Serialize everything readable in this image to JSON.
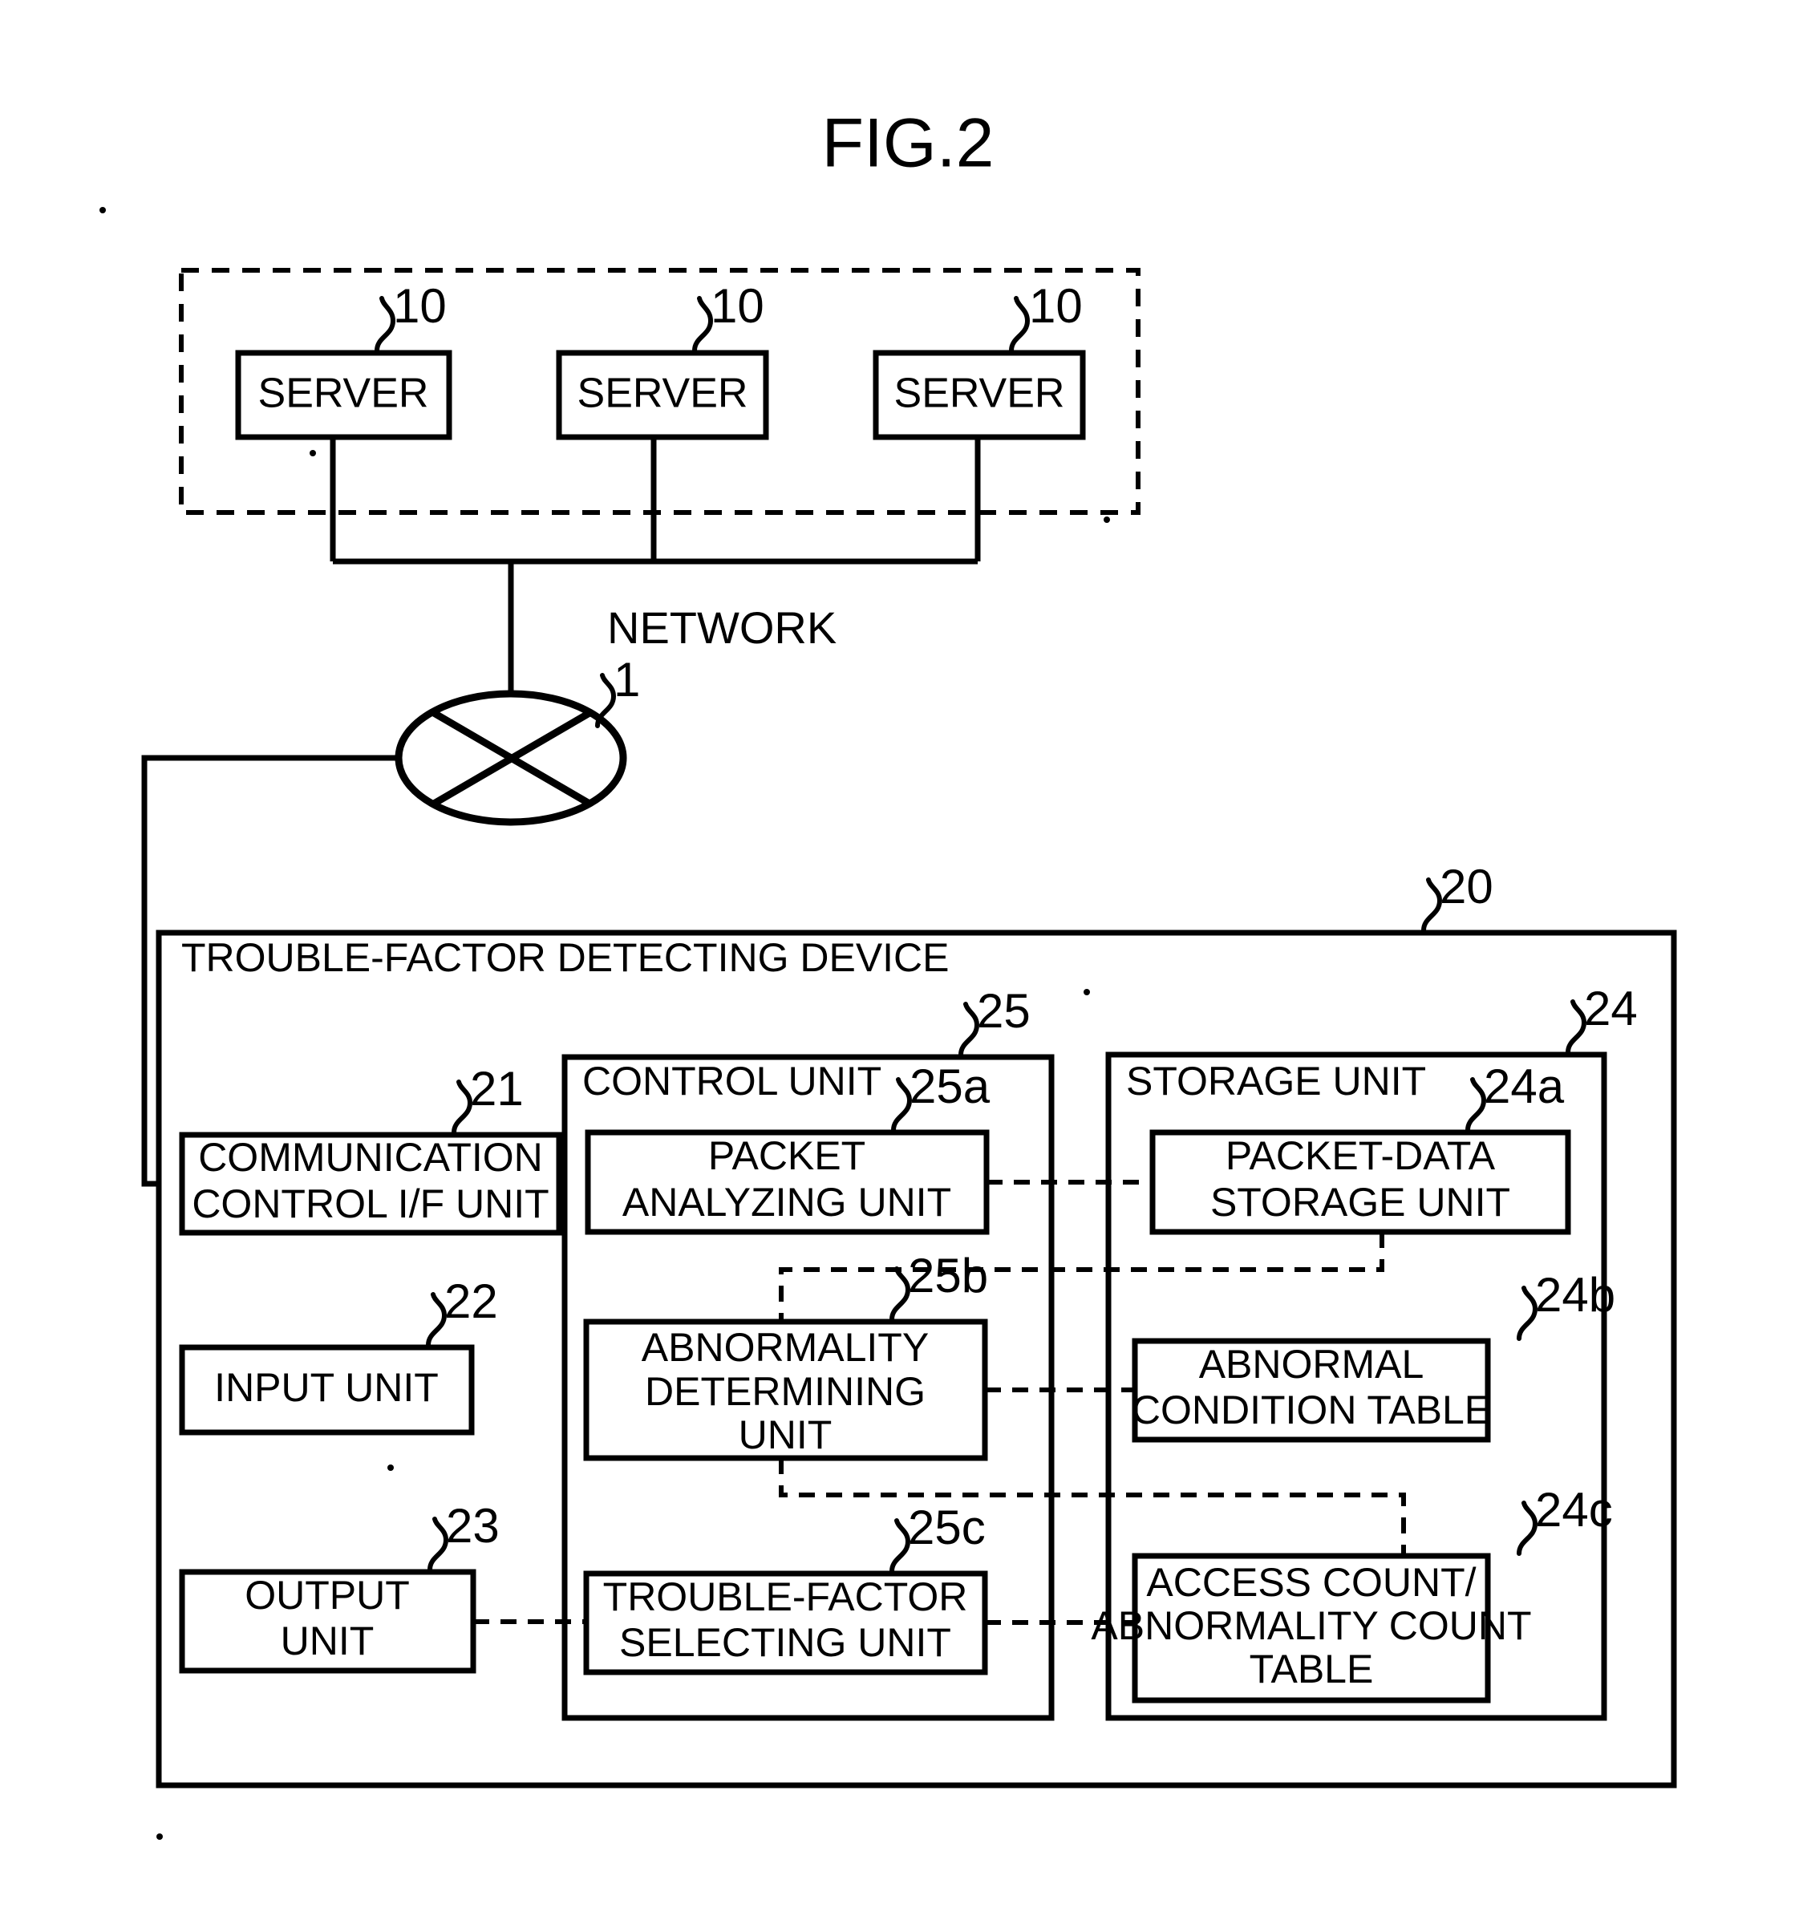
{
  "figure": {
    "title": "FIG.2",
    "caption_network": "NETWORK",
    "device_title": "TROUBLE-FACTOR DETECTING DEVICE"
  },
  "servers": {
    "label": "SERVER",
    "ref": "10",
    "items": [
      {
        "label": "SERVER",
        "ref": "10"
      },
      {
        "label": "SERVER",
        "ref": "10"
      },
      {
        "label": "SERVER",
        "ref": "10"
      }
    ]
  },
  "network": {
    "label": "NETWORK",
    "ref": "1"
  },
  "device": {
    "ref": "20",
    "title": "TROUBLE-FACTOR DETECTING DEVICE",
    "left_column": [
      {
        "ref": "21",
        "line1": "COMMUNICATION",
        "line2": "CONTROL I/F UNIT"
      },
      {
        "ref": "22",
        "line1": "INPUT UNIT",
        "line2": ""
      },
      {
        "ref": "23",
        "line1": "OUTPUT",
        "line2": "UNIT"
      }
    ],
    "control_unit": {
      "ref": "25",
      "title": "CONTROL UNIT",
      "items": [
        {
          "ref": "25a",
          "line1": "PACKET",
          "line2": "ANALYZING UNIT",
          "line3": ""
        },
        {
          "ref": "25b",
          "line1": "ABNORMALITY",
          "line2": "DETERMINING",
          "line3": "UNIT"
        },
        {
          "ref": "25c",
          "line1": "TROUBLE-FACTOR",
          "line2": "SELECTING UNIT",
          "line3": ""
        }
      ]
    },
    "storage_unit": {
      "ref": "24",
      "title": "STORAGE UNIT",
      "items": [
        {
          "ref": "24a",
          "line1": "PACKET-DATA",
          "line2": "STORAGE UNIT",
          "line3": ""
        },
        {
          "ref": "24b",
          "line1": "ABNORMAL",
          "line2": "CONDITION TABLE",
          "line3": ""
        },
        {
          "ref": "24c",
          "line1": "ACCESS COUNT/",
          "line2": "ABNORMALITY COUNT",
          "line3": "TABLE"
        }
      ]
    }
  },
  "colors": {
    "ink": "#000000",
    "paper": "#ffffff"
  }
}
